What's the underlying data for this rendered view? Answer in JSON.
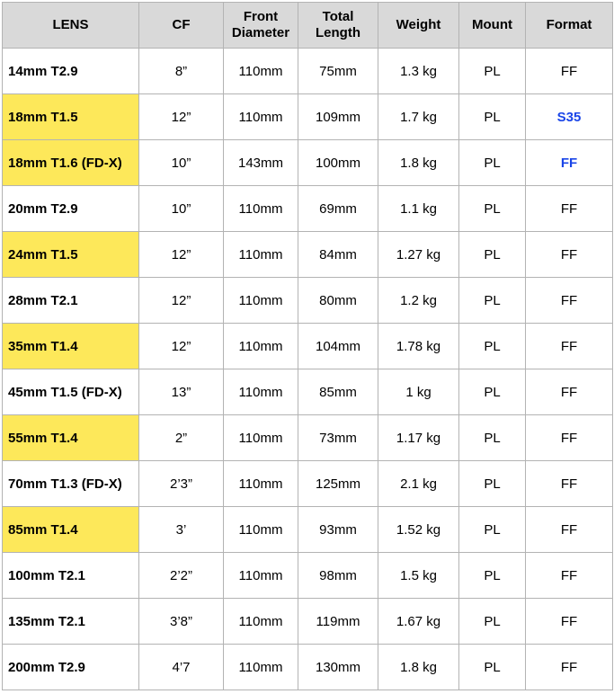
{
  "headers": {
    "lens": "LENS",
    "cf": "CF",
    "front_1": "Front",
    "front_2": "Diameter",
    "total_1": "Total",
    "total_2": "Length",
    "weight": "Weight",
    "mount": "Mount",
    "format": "Format"
  },
  "colors": {
    "header_bg": "#d9d9d9",
    "highlight": "#fde85a",
    "blue_text": "#1a45e8",
    "border": "#b3b3b3"
  },
  "rows": [
    {
      "lens": "14mm T2.9",
      "cf": "8”",
      "front": "110mm",
      "length": "75mm",
      "weight": "1.3 kg",
      "mount": "PL",
      "format": "FF",
      "highlight": false,
      "format_blue": false
    },
    {
      "lens": "18mm T1.5",
      "cf": "12”",
      "front": "110mm",
      "length": "109mm",
      "weight": "1.7 kg",
      "mount": "PL",
      "format": "S35",
      "highlight": true,
      "format_blue": true
    },
    {
      "lens": "18mm T1.6 (FD-X)",
      "cf": "10”",
      "front": "143mm",
      "length": "100mm",
      "weight": "1.8 kg",
      "mount": "PL",
      "format": "FF",
      "highlight": true,
      "format_blue": true
    },
    {
      "lens": "20mm T2.9",
      "cf": "10”",
      "front": "110mm",
      "length": "69mm",
      "weight": "1.1 kg",
      "mount": "PL",
      "format": "FF",
      "highlight": false,
      "format_blue": false
    },
    {
      "lens": "24mm T1.5",
      "cf": "12”",
      "front": "110mm",
      "length": "84mm",
      "weight": "1.27 kg",
      "mount": "PL",
      "format": "FF",
      "highlight": true,
      "format_blue": false
    },
    {
      "lens": "28mm T2.1",
      "cf": "12”",
      "front": "110mm",
      "length": "80mm",
      "weight": "1.2 kg",
      "mount": "PL",
      "format": "FF",
      "highlight": false,
      "format_blue": false
    },
    {
      "lens": "35mm T1.4",
      "cf": "12”",
      "front": "110mm",
      "length": "104mm",
      "weight": "1.78 kg",
      "mount": "PL",
      "format": "FF",
      "highlight": true,
      "format_blue": false
    },
    {
      "lens": "45mm T1.5 (FD-X)",
      "cf": "13”",
      "front": "110mm",
      "length": "85mm",
      "weight": "1 kg",
      "mount": "PL",
      "format": "FF",
      "highlight": false,
      "format_blue": false
    },
    {
      "lens": "55mm T1.4",
      "cf": "2”",
      "front": "110mm",
      "length": "73mm",
      "weight": "1.17 kg",
      "mount": "PL",
      "format": "FF",
      "highlight": true,
      "format_blue": false
    },
    {
      "lens": "70mm T1.3 (FD-X)",
      "cf": "2’3”",
      "front": "110mm",
      "length": "125mm",
      "weight": "2.1 kg",
      "mount": "PL",
      "format": "FF",
      "highlight": false,
      "format_blue": false
    },
    {
      "lens": "85mm T1.4",
      "cf": "3’",
      "front": "110mm",
      "length": "93mm",
      "weight": "1.52 kg",
      "mount": "PL",
      "format": "FF",
      "highlight": true,
      "format_blue": false
    },
    {
      "lens": "100mm T2.1",
      "cf": "2’2”",
      "front": "110mm",
      "length": "98mm",
      "weight": "1.5 kg",
      "mount": "PL",
      "format": "FF",
      "highlight": false,
      "format_blue": false
    },
    {
      "lens": "135mm T2.1",
      "cf": "3’8”",
      "front": "110mm",
      "length": "119mm",
      "weight": "1.67 kg",
      "mount": "PL",
      "format": "FF",
      "highlight": false,
      "format_blue": false
    },
    {
      "lens": "200mm T2.9",
      "cf": "4’7",
      "front": "110mm",
      "length": "130mm",
      "weight": "1.8 kg",
      "mount": "PL",
      "format": "FF",
      "highlight": false,
      "format_blue": false
    }
  ]
}
